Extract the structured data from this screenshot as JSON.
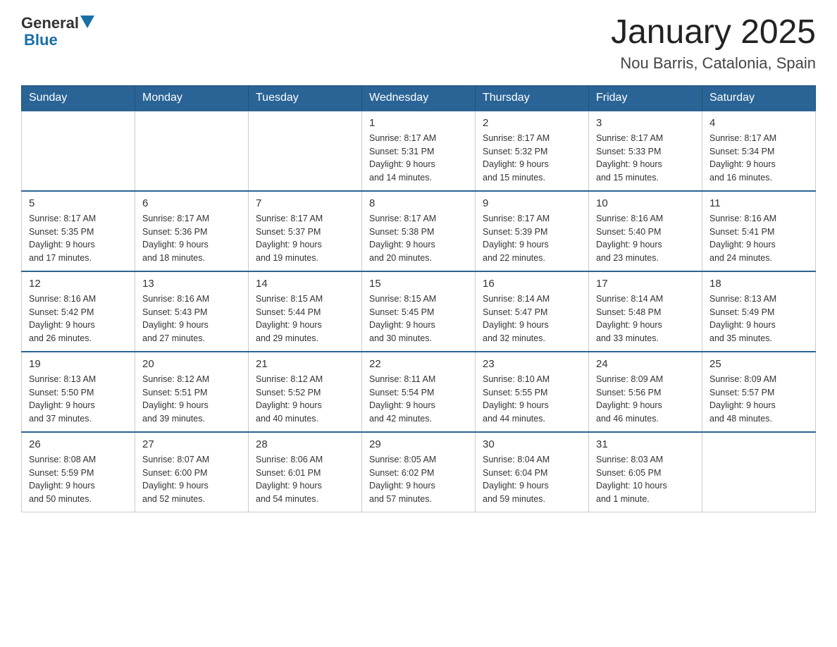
{
  "header": {
    "logo": {
      "general": "General",
      "blue": "Blue"
    },
    "title": "January 2025",
    "location": "Nou Barris, Catalonia, Spain"
  },
  "weekdays": [
    "Sunday",
    "Monday",
    "Tuesday",
    "Wednesday",
    "Thursday",
    "Friday",
    "Saturday"
  ],
  "weeks": [
    [
      {
        "day": "",
        "info": ""
      },
      {
        "day": "",
        "info": ""
      },
      {
        "day": "",
        "info": ""
      },
      {
        "day": "1",
        "info": "Sunrise: 8:17 AM\nSunset: 5:31 PM\nDaylight: 9 hours\nand 14 minutes."
      },
      {
        "day": "2",
        "info": "Sunrise: 8:17 AM\nSunset: 5:32 PM\nDaylight: 9 hours\nand 15 minutes."
      },
      {
        "day": "3",
        "info": "Sunrise: 8:17 AM\nSunset: 5:33 PM\nDaylight: 9 hours\nand 15 minutes."
      },
      {
        "day": "4",
        "info": "Sunrise: 8:17 AM\nSunset: 5:34 PM\nDaylight: 9 hours\nand 16 minutes."
      }
    ],
    [
      {
        "day": "5",
        "info": "Sunrise: 8:17 AM\nSunset: 5:35 PM\nDaylight: 9 hours\nand 17 minutes."
      },
      {
        "day": "6",
        "info": "Sunrise: 8:17 AM\nSunset: 5:36 PM\nDaylight: 9 hours\nand 18 minutes."
      },
      {
        "day": "7",
        "info": "Sunrise: 8:17 AM\nSunset: 5:37 PM\nDaylight: 9 hours\nand 19 minutes."
      },
      {
        "day": "8",
        "info": "Sunrise: 8:17 AM\nSunset: 5:38 PM\nDaylight: 9 hours\nand 20 minutes."
      },
      {
        "day": "9",
        "info": "Sunrise: 8:17 AM\nSunset: 5:39 PM\nDaylight: 9 hours\nand 22 minutes."
      },
      {
        "day": "10",
        "info": "Sunrise: 8:16 AM\nSunset: 5:40 PM\nDaylight: 9 hours\nand 23 minutes."
      },
      {
        "day": "11",
        "info": "Sunrise: 8:16 AM\nSunset: 5:41 PM\nDaylight: 9 hours\nand 24 minutes."
      }
    ],
    [
      {
        "day": "12",
        "info": "Sunrise: 8:16 AM\nSunset: 5:42 PM\nDaylight: 9 hours\nand 26 minutes."
      },
      {
        "day": "13",
        "info": "Sunrise: 8:16 AM\nSunset: 5:43 PM\nDaylight: 9 hours\nand 27 minutes."
      },
      {
        "day": "14",
        "info": "Sunrise: 8:15 AM\nSunset: 5:44 PM\nDaylight: 9 hours\nand 29 minutes."
      },
      {
        "day": "15",
        "info": "Sunrise: 8:15 AM\nSunset: 5:45 PM\nDaylight: 9 hours\nand 30 minutes."
      },
      {
        "day": "16",
        "info": "Sunrise: 8:14 AM\nSunset: 5:47 PM\nDaylight: 9 hours\nand 32 minutes."
      },
      {
        "day": "17",
        "info": "Sunrise: 8:14 AM\nSunset: 5:48 PM\nDaylight: 9 hours\nand 33 minutes."
      },
      {
        "day": "18",
        "info": "Sunrise: 8:13 AM\nSunset: 5:49 PM\nDaylight: 9 hours\nand 35 minutes."
      }
    ],
    [
      {
        "day": "19",
        "info": "Sunrise: 8:13 AM\nSunset: 5:50 PM\nDaylight: 9 hours\nand 37 minutes."
      },
      {
        "day": "20",
        "info": "Sunrise: 8:12 AM\nSunset: 5:51 PM\nDaylight: 9 hours\nand 39 minutes."
      },
      {
        "day": "21",
        "info": "Sunrise: 8:12 AM\nSunset: 5:52 PM\nDaylight: 9 hours\nand 40 minutes."
      },
      {
        "day": "22",
        "info": "Sunrise: 8:11 AM\nSunset: 5:54 PM\nDaylight: 9 hours\nand 42 minutes."
      },
      {
        "day": "23",
        "info": "Sunrise: 8:10 AM\nSunset: 5:55 PM\nDaylight: 9 hours\nand 44 minutes."
      },
      {
        "day": "24",
        "info": "Sunrise: 8:09 AM\nSunset: 5:56 PM\nDaylight: 9 hours\nand 46 minutes."
      },
      {
        "day": "25",
        "info": "Sunrise: 8:09 AM\nSunset: 5:57 PM\nDaylight: 9 hours\nand 48 minutes."
      }
    ],
    [
      {
        "day": "26",
        "info": "Sunrise: 8:08 AM\nSunset: 5:59 PM\nDaylight: 9 hours\nand 50 minutes."
      },
      {
        "day": "27",
        "info": "Sunrise: 8:07 AM\nSunset: 6:00 PM\nDaylight: 9 hours\nand 52 minutes."
      },
      {
        "day": "28",
        "info": "Sunrise: 8:06 AM\nSunset: 6:01 PM\nDaylight: 9 hours\nand 54 minutes."
      },
      {
        "day": "29",
        "info": "Sunrise: 8:05 AM\nSunset: 6:02 PM\nDaylight: 9 hours\nand 57 minutes."
      },
      {
        "day": "30",
        "info": "Sunrise: 8:04 AM\nSunset: 6:04 PM\nDaylight: 9 hours\nand 59 minutes."
      },
      {
        "day": "31",
        "info": "Sunrise: 8:03 AM\nSunset: 6:05 PM\nDaylight: 10 hours\nand 1 minute."
      },
      {
        "day": "",
        "info": ""
      }
    ]
  ]
}
